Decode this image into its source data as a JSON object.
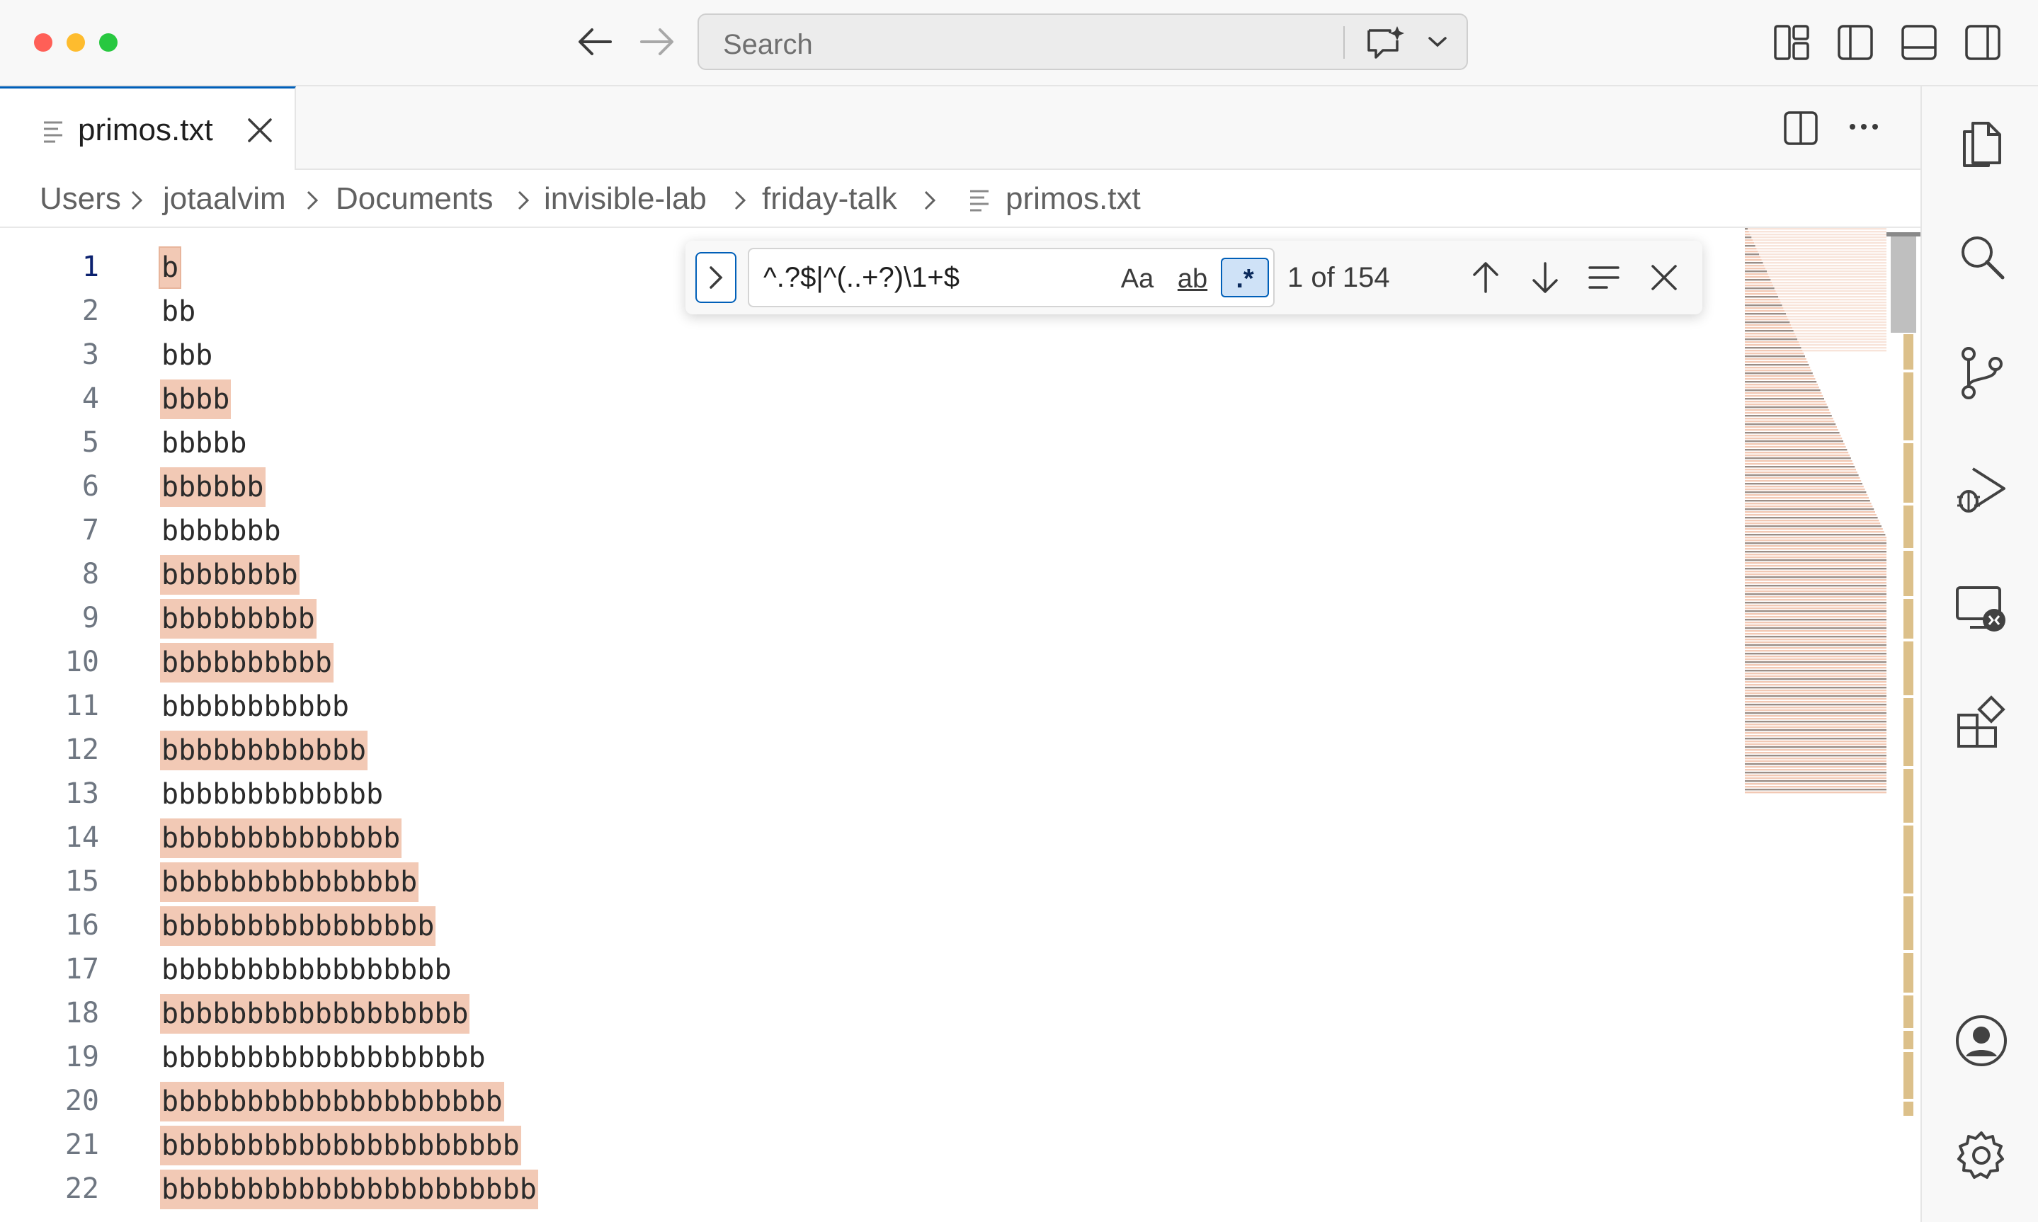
{
  "titlebar": {
    "search_placeholder": "Search"
  },
  "tab": {
    "label": "primos.txt"
  },
  "breadcrumb": {
    "items": [
      "Users",
      "jotaalvim",
      "Documents",
      "invisible-lab",
      "friday-talk",
      "primos.txt"
    ]
  },
  "find": {
    "query": "^.?$|^(..+?)\\1+$",
    "match_case_label": "Aa",
    "whole_word_label": "ab",
    "regex_label": ".*",
    "count": "1 of 154"
  },
  "editor": {
    "current_line": 1,
    "lines": [
      {
        "n": "1",
        "text": "b",
        "match": true
      },
      {
        "n": "2",
        "text": "bb",
        "match": false
      },
      {
        "n": "3",
        "text": "bbb",
        "match": false
      },
      {
        "n": "4",
        "text": "bbbb",
        "match": true
      },
      {
        "n": "5",
        "text": "bbbbb",
        "match": false
      },
      {
        "n": "6",
        "text": "bbbbbb",
        "match": true
      },
      {
        "n": "7",
        "text": "bbbbbbb",
        "match": false
      },
      {
        "n": "8",
        "text": "bbbbbbbb",
        "match": true
      },
      {
        "n": "9",
        "text": "bbbbbbbbb",
        "match": true
      },
      {
        "n": "10",
        "text": "bbbbbbbbbb",
        "match": true
      },
      {
        "n": "11",
        "text": "bbbbbbbbbbb",
        "match": false
      },
      {
        "n": "12",
        "text": "bbbbbbbbbbbb",
        "match": true
      },
      {
        "n": "13",
        "text": "bbbbbbbbbbbbb",
        "match": false
      },
      {
        "n": "14",
        "text": "bbbbbbbbbbbbbb",
        "match": true
      },
      {
        "n": "15",
        "text": "bbbbbbbbbbbbbbb",
        "match": true
      },
      {
        "n": "16",
        "text": "bbbbbbbbbbbbbbbb",
        "match": true
      },
      {
        "n": "17",
        "text": "bbbbbbbbbbbbbbbbb",
        "match": false
      },
      {
        "n": "18",
        "text": "bbbbbbbbbbbbbbbbbb",
        "match": true
      },
      {
        "n": "19",
        "text": "bbbbbbbbbbbbbbbbbbb",
        "match": false
      },
      {
        "n": "20",
        "text": "bbbbbbbbbbbbbbbbbbbb",
        "match": true
      },
      {
        "n": "21",
        "text": "bbbbbbbbbbbbbbbbbbbbb",
        "match": true
      },
      {
        "n": "22",
        "text": "bbbbbbbbbbbbbbbbbbbbbb",
        "match": true
      }
    ]
  },
  "icons": {
    "titlebar": [
      "back-arrow-icon",
      "forward-arrow-icon",
      "copilot-chat-icon",
      "chevron-down-icon",
      "customize-layout-icon",
      "toggle-primary-sidebar-icon",
      "toggle-panel-icon",
      "toggle-secondary-sidebar-icon"
    ],
    "activity": [
      "explorer-icon",
      "search-icon",
      "source-control-icon",
      "run-debug-icon",
      "remote-explorer-icon",
      "extensions-icon",
      "accounts-icon",
      "manage-gear-icon"
    ]
  },
  "colors": {
    "accent": "#005fb8",
    "match_highlight": "#f2c9b5",
    "scroll_marker": "#dcc08a"
  }
}
